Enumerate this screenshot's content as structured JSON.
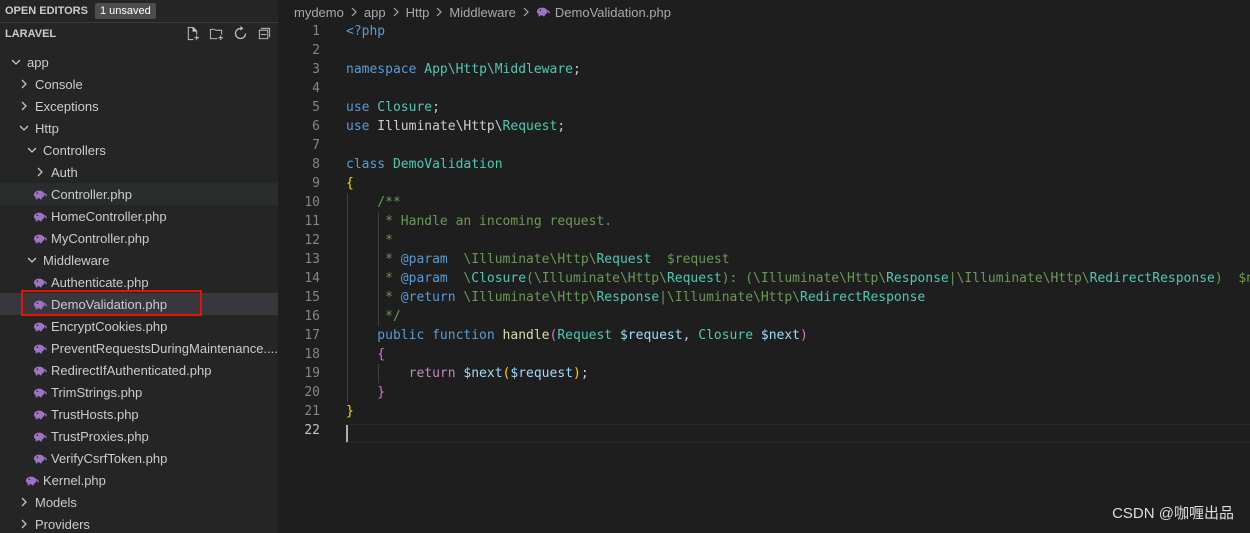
{
  "open_editors": {
    "title": "OPEN EDITORS",
    "badge": "1 unsaved"
  },
  "project": {
    "title": "LARAVEL"
  },
  "tree": [
    {
      "label": "app",
      "type": "folder-open",
      "depth": 0
    },
    {
      "label": "Console",
      "type": "folder",
      "depth": 1
    },
    {
      "label": "Exceptions",
      "type": "folder",
      "depth": 1
    },
    {
      "label": "Http",
      "type": "folder-open",
      "depth": 1
    },
    {
      "label": "Controllers",
      "type": "folder-open",
      "depth": 2
    },
    {
      "label": "Auth",
      "type": "folder",
      "depth": 3
    },
    {
      "label": "Controller.php",
      "type": "php",
      "depth": 3
    },
    {
      "label": "HomeController.php",
      "type": "php",
      "depth": 3
    },
    {
      "label": "MyController.php",
      "type": "php",
      "depth": 3
    },
    {
      "label": "Middleware",
      "type": "folder-open",
      "depth": 2
    },
    {
      "label": "Authenticate.php",
      "type": "php",
      "depth": 3
    },
    {
      "label": "DemoValidation.php",
      "type": "php",
      "depth": 3,
      "selected": true
    },
    {
      "label": "EncryptCookies.php",
      "type": "php",
      "depth": 3
    },
    {
      "label": "PreventRequestsDuringMaintenance....",
      "type": "php",
      "depth": 3
    },
    {
      "label": "RedirectIfAuthenticated.php",
      "type": "php",
      "depth": 3
    },
    {
      "label": "TrimStrings.php",
      "type": "php",
      "depth": 3
    },
    {
      "label": "TrustHosts.php",
      "type": "php",
      "depth": 3
    },
    {
      "label": "TrustProxies.php",
      "type": "php",
      "depth": 3
    },
    {
      "label": "VerifyCsrfToken.php",
      "type": "php",
      "depth": 3
    },
    {
      "label": "Kernel.php",
      "type": "php",
      "depth": 2
    },
    {
      "label": "Models",
      "type": "folder",
      "depth": 1
    },
    {
      "label": "Providers",
      "type": "folder",
      "depth": 1
    }
  ],
  "breadcrumb": [
    "mydemo",
    "app",
    "Http",
    "Middleware",
    "DemoValidation.php"
  ],
  "code_lines": [
    [
      [
        "kw",
        "<?php"
      ]
    ],
    [],
    [
      [
        "kw",
        "namespace"
      ],
      [
        "",
        ""
      ],
      [
        "ty",
        " App\\Http\\Middleware"
      ],
      [
        "",
        ";"
      ]
    ],
    [],
    [
      [
        "kw",
        "use"
      ],
      [
        "ty",
        " Closure"
      ],
      [
        "",
        ";"
      ]
    ],
    [
      [
        "kw",
        "use"
      ],
      [
        "",
        " Illuminate\\Http\\"
      ],
      [
        "ty",
        "Request"
      ],
      [
        "",
        ";"
      ]
    ],
    [],
    [
      [
        "kw",
        "class"
      ],
      [
        "ty",
        " DemoValidation"
      ]
    ],
    [
      [
        "br",
        "{"
      ]
    ],
    [
      [
        "cm",
        "    /**"
      ]
    ],
    [
      [
        "cm",
        "     * Handle an incoming request."
      ]
    ],
    [
      [
        "cm",
        "     *"
      ]
    ],
    [
      [
        "cm",
        "     * "
      ],
      [
        "kw",
        "@param"
      ],
      [
        "cm",
        "  \\Illuminate\\Http\\"
      ],
      [
        "ty",
        "Request"
      ],
      [
        "cm",
        "  $request"
      ]
    ],
    [
      [
        "cm",
        "     * "
      ],
      [
        "kw",
        "@param"
      ],
      [
        "cm",
        "  \\"
      ],
      [
        "ty",
        "Closure"
      ],
      [
        "cm",
        "(\\Illuminate\\Http\\"
      ],
      [
        "ty",
        "Request"
      ],
      [
        "cm",
        "): (\\Illuminate\\Http\\"
      ],
      [
        "ty",
        "Response"
      ],
      [
        "cm",
        "|\\Illuminate\\Http\\"
      ],
      [
        "ty",
        "RedirectResponse"
      ],
      [
        "cm",
        ")  $next"
      ]
    ],
    [
      [
        "cm",
        "     * "
      ],
      [
        "kw",
        "@return"
      ],
      [
        "cm",
        " \\Illuminate\\Http\\"
      ],
      [
        "ty",
        "Response"
      ],
      [
        "cm",
        "|\\Illuminate\\Http\\"
      ],
      [
        "ty",
        "RedirectResponse"
      ]
    ],
    [
      [
        "cm",
        "     */"
      ]
    ],
    [
      [
        "kw",
        "    public function"
      ],
      [
        "fn",
        " handle"
      ],
      [
        "br2",
        "("
      ],
      [
        "ty",
        "Request"
      ],
      [
        "vr",
        " $request"
      ],
      [
        "",
        ", "
      ],
      [
        "ty",
        "Closure"
      ],
      [
        "vr",
        " $next"
      ],
      [
        "br2",
        ")"
      ]
    ],
    [
      [
        "br2",
        "    {"
      ]
    ],
    [
      [
        "kw2",
        "        return"
      ],
      [
        "vr",
        " $next"
      ],
      [
        "br",
        "("
      ],
      [
        "vr",
        "$request"
      ],
      [
        "br",
        ")"
      ],
      [
        "",
        ";"
      ]
    ],
    [
      [
        "br2",
        "    }"
      ]
    ],
    [
      [
        "br",
        "}"
      ]
    ],
    []
  ],
  "watermark": "CSDN @咖喱出品",
  "colors": {
    "accent": "#e51400",
    "php_icon": "#a074c4"
  }
}
